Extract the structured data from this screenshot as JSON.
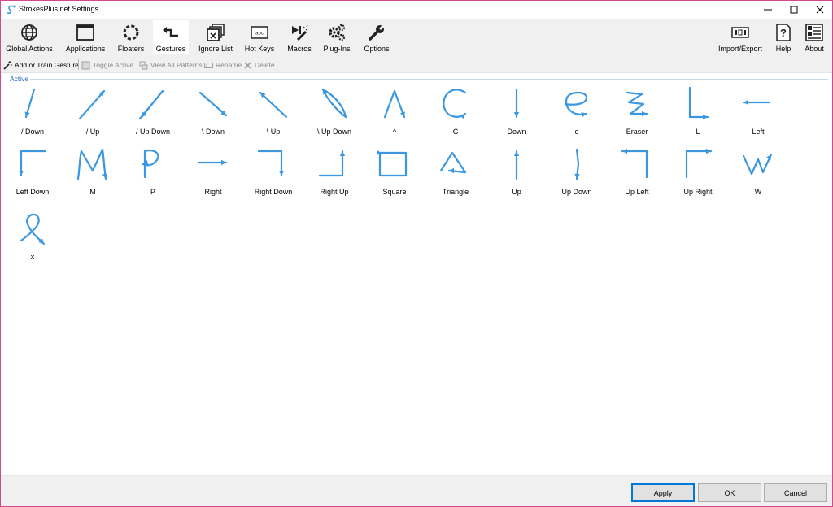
{
  "window": {
    "title": "StrokesPlus.net Settings"
  },
  "toolbar": {
    "items": [
      {
        "label": "Global Actions",
        "icon": "globe-icon"
      },
      {
        "label": "Applications",
        "icon": "window-icon"
      },
      {
        "label": "Floaters",
        "icon": "floater-ring-icon"
      },
      {
        "label": "Gestures",
        "icon": "gesture-arrow-icon",
        "selected": true
      },
      {
        "label": "Ignore List",
        "icon": "ignore-windows-icon"
      },
      {
        "label": "Hot Keys",
        "icon": "keyboard-icon"
      },
      {
        "label": "Macros",
        "icon": "macro-wand-icon"
      },
      {
        "label": "Plug-Ins",
        "icon": "plugin-gears-icon"
      },
      {
        "label": "Options",
        "icon": "wrench-icon"
      }
    ],
    "right_items": [
      {
        "label": "Import/Export",
        "icon": "import-export-icon"
      },
      {
        "label": "Help",
        "icon": "help-icon"
      },
      {
        "label": "About",
        "icon": "about-icon"
      }
    ]
  },
  "subtoolbar": {
    "add_train": "Add or Train Gesture",
    "toggle_active": "Toggle Active",
    "view_all_patterns": "View All Patterns",
    "rename": "Rename",
    "delete": "Delete"
  },
  "group": {
    "label": "Active"
  },
  "gestures": [
    {
      "label": "/ Down"
    },
    {
      "label": "/ Up"
    },
    {
      "label": "/ Up Down"
    },
    {
      "label": "\\ Down"
    },
    {
      "label": "\\ Up"
    },
    {
      "label": "\\ Up Down"
    },
    {
      "label": "^"
    },
    {
      "label": "C"
    },
    {
      "label": "Down"
    },
    {
      "label": "e"
    },
    {
      "label": "Eraser"
    },
    {
      "label": "L"
    },
    {
      "label": "Left"
    },
    {
      "label": "Left Down"
    },
    {
      "label": "M"
    },
    {
      "label": "P"
    },
    {
      "label": "Right"
    },
    {
      "label": "Right Down"
    },
    {
      "label": "Right Up"
    },
    {
      "label": "Square"
    },
    {
      "label": "Triangle"
    },
    {
      "label": "Up"
    },
    {
      "label": "Up Down"
    },
    {
      "label": "Up Left"
    },
    {
      "label": "Up Right"
    },
    {
      "label": "W"
    },
    {
      "label": "x"
    }
  ],
  "buttons": {
    "apply": "Apply",
    "ok": "OK",
    "cancel": "Cancel"
  },
  "colors": {
    "stroke": "#3a97e0",
    "accent": "#0078d7"
  }
}
